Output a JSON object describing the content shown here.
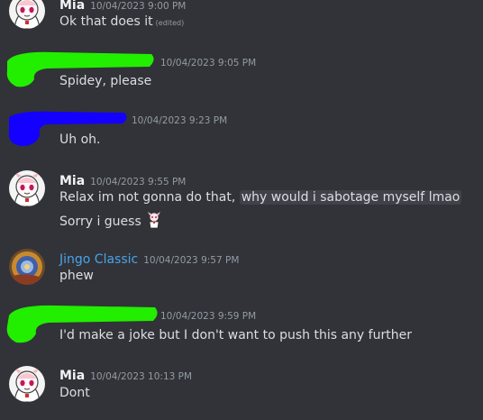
{
  "colors": {
    "background": "#313338",
    "text": "#dbdee1",
    "timestamp": "#949ba4",
    "jingo_name": "#4aa3e8",
    "redact_green": "#22ee00",
    "redact_blue": "#1400ff"
  },
  "messages": [
    {
      "author": "Mia",
      "timestamp": "10/04/2023 9:00 PM",
      "lines": [
        "Ok that does it"
      ],
      "edited": "(edited)"
    },
    {
      "author": "",
      "timestamp": "10/04/2023 9:05 PM",
      "lines": [
        "Spidey, please"
      ]
    },
    {
      "author": "",
      "timestamp": "10/04/2023 9:23 PM",
      "lines": [
        "Uh oh."
      ]
    },
    {
      "author": "Mia",
      "timestamp": "10/04/2023 9:55 PM",
      "lines": [
        "Relax im not gonna do that, ",
        "why would i sabotage myself lmao",
        "Sorry i guess"
      ]
    },
    {
      "author": "Jingo Classic",
      "timestamp": "10/04/2023 9:57 PM",
      "lines": [
        "phew"
      ]
    },
    {
      "author": "",
      "timestamp": "10/04/2023 9:59 PM",
      "lines": [
        "I'd make a joke but I don't want to push this any further"
      ]
    },
    {
      "author": "Mia",
      "timestamp": "10/04/2023 10:13 PM",
      "lines": [
        "Dont"
      ]
    }
  ]
}
